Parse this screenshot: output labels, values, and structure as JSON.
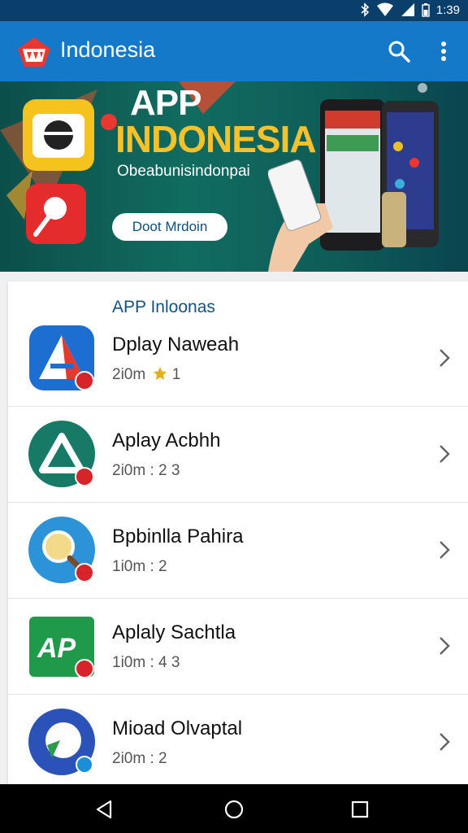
{
  "status_bar": {
    "time": "1:39"
  },
  "app_bar": {
    "title": "Indonesia"
  },
  "banner": {
    "headline_line1": "APP",
    "headline_line2": "INDONESIA",
    "subtitle": "Obeabunisindonpai",
    "cta_label": "Doot Mrdoin"
  },
  "list": {
    "title": "APP Inloonas",
    "items": [
      {
        "name": "Dplay Naweah",
        "meta": "2i0m",
        "rating": "1",
        "icon": "triangle-a-icon",
        "color": "#1c6fd1"
      },
      {
        "name": "Aplay Acbhh",
        "meta": "2i0m : 2 3",
        "icon": "delta-a-icon",
        "color": "#167a66"
      },
      {
        "name": "Bpbinlla Pahira",
        "meta": "1i0m : 2",
        "icon": "magnifier-icon",
        "color": "#2c93d8"
      },
      {
        "name": "Aplaly Sachtla",
        "meta": "1i0m : 4 3",
        "icon": "ap-letters-icon",
        "color": "#1f9a4b"
      },
      {
        "name": "Mioad Olvaptal",
        "meta": "2i0m : 2",
        "icon": "map-pin-icon",
        "color": "#2a52b8"
      }
    ]
  },
  "colors": {
    "app_bar": "#1479c9",
    "status_bar": "#0a3f6b",
    "banner_accent": "#f7c12a"
  }
}
